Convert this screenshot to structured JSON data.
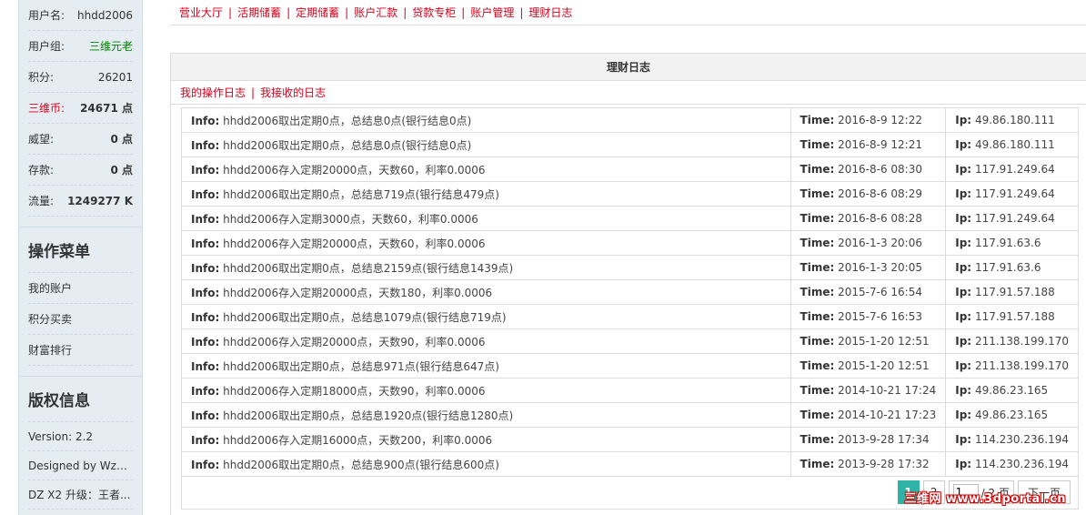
{
  "sidebar": {
    "user_rows": [
      {
        "label": "用户名:",
        "value": "hhdd2006"
      },
      {
        "label": "用户组:",
        "value": "三维元老"
      },
      {
        "label": "积分:",
        "value": "26201"
      },
      {
        "label": "三维币:",
        "value": "24671 点"
      },
      {
        "label": "威望:",
        "value": "0 点"
      },
      {
        "label": "存款:",
        "value": "0 点"
      },
      {
        "label": "流量:",
        "value": "1249277 K"
      }
    ],
    "menu_title": "操作菜单",
    "menu_items": [
      "我的账户",
      "积分买卖",
      "财富排行"
    ],
    "copyright_title": "版权信息",
    "copyright_lines": [
      "Version: 2.2",
      "Designed by Wz20...",
      "DZ X2 升级：王者..."
    ]
  },
  "topnav": [
    "营业大厅",
    "活期储蓄",
    "定期储蓄",
    "账户汇款",
    "贷款专柜",
    "账户管理",
    "理财日志"
  ],
  "panel": {
    "title": "理财日志",
    "subtabs": [
      "我的操作日志",
      "我接收的日志"
    ]
  },
  "labels": {
    "info": "Info:",
    "time": "Time:",
    "ip": "Ip:"
  },
  "logs": [
    {
      "info": "hhdd2006取出定期0点，总结息0点(银行结息0点)",
      "time": "2016-8-9 12:22",
      "ip": "49.86.180.111"
    },
    {
      "info": "hhdd2006取出定期0点，总结息0点(银行结息0点)",
      "time": "2016-8-9 12:21",
      "ip": "49.86.180.111"
    },
    {
      "info": "hhdd2006存入定期20000点，天数60，利率0.0006",
      "time": "2016-8-6 08:30",
      "ip": "117.91.249.64"
    },
    {
      "info": "hhdd2006取出定期0点，总结息719点(银行结息479点)",
      "time": "2016-8-6 08:29",
      "ip": "117.91.249.64"
    },
    {
      "info": "hhdd2006存入定期3000点，天数60，利率0.0006",
      "time": "2016-8-6 08:28",
      "ip": "117.91.249.64"
    },
    {
      "info": "hhdd2006存入定期20000点，天数60，利率0.0006",
      "time": "2016-1-3 20:06",
      "ip": "117.91.63.6"
    },
    {
      "info": "hhdd2006取出定期0点，总结息2159点(银行结息1439点)",
      "time": "2016-1-3 20:05",
      "ip": "117.91.63.6"
    },
    {
      "info": "hhdd2006存入定期20000点，天数180，利率0.0006",
      "time": "2015-7-6 16:54",
      "ip": "117.91.57.188"
    },
    {
      "info": "hhdd2006取出定期0点，总结息1079点(银行结息719点)",
      "time": "2015-7-6 16:53",
      "ip": "117.91.57.188"
    },
    {
      "info": "hhdd2006存入定期20000点，天数90，利率0.0006",
      "time": "2015-1-20 12:51",
      "ip": "211.138.199.170"
    },
    {
      "info": "hhdd2006取出定期0点，总结息971点(银行结息647点)",
      "time": "2015-1-20 12:51",
      "ip": "211.138.199.170"
    },
    {
      "info": "hhdd2006存入定期18000点，天数90，利率0.0006",
      "time": "2014-10-21 17:24",
      "ip": "49.86.23.165"
    },
    {
      "info": "hhdd2006取出定期0点，总结息1920点(银行结息1280点)",
      "time": "2014-10-21 17:23",
      "ip": "49.86.23.165"
    },
    {
      "info": "hhdd2006存入定期16000点，天数200，利率0.0006",
      "time": "2013-9-28 17:34",
      "ip": "114.230.236.194"
    },
    {
      "info": "hhdd2006取出定期0点，总结息900点(银行结息600点)",
      "time": "2013-9-28 17:32",
      "ip": "114.230.236.194"
    }
  ],
  "pager": {
    "pages": [
      "1",
      "2"
    ],
    "current_input": "1",
    "total": "/ 2 页",
    "next": "下一页"
  },
  "watermark": "三维网 www.3dportal.cn",
  "colors": {
    "accent_red": "#d6001c",
    "sidebar_bg": "#e5edf2",
    "pager_active": "#2eb3a6",
    "group_green": "#008000"
  }
}
